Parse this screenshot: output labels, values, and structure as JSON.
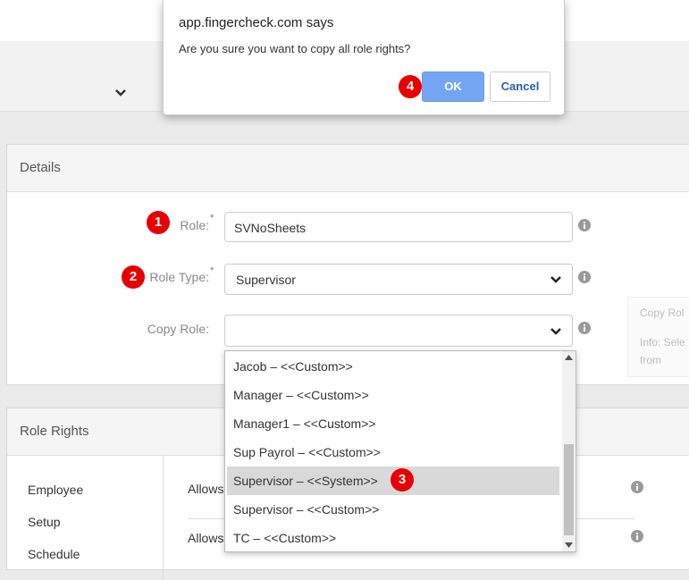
{
  "dialog": {
    "title": "app.fingercheck.com says",
    "message": "Are you sure you want to copy all role rights?",
    "ok_label": "OK",
    "cancel_label": "Cancel"
  },
  "details": {
    "heading": "Details",
    "role_label": "Role:",
    "role_value": "SVNoSheets",
    "role_type_label": "Role Type:",
    "role_type_value": "Supervisor",
    "copy_role_label": "Copy Role:",
    "copy_role_value": "",
    "required_mark": "*"
  },
  "side_tip": {
    "line1": "Copy Rol",
    "line2": "Info: Sele",
    "line3": "from"
  },
  "copy_role_options": [
    "Jacob – <<Custom>>",
    "Manager – <<Custom>>",
    "Manager1 – <<Custom>>",
    "Sup Payrol – <<Custom>>",
    "Supervisor – <<System>>",
    "Supervisor – <<Custom>>",
    "TC – <<Custom>>"
  ],
  "selected_option": "Supervisor – <<System>>",
  "role_rights": {
    "heading": "Role Rights",
    "nav": [
      "Employee",
      "Setup",
      "Schedule"
    ],
    "row_prefix_1": "Allows",
    "row_prefix_2": "Allows"
  },
  "badges": [
    "1",
    "2",
    "3",
    "4"
  ],
  "colors": {
    "badge": "#e60000",
    "ok_button": "#73a5f2",
    "cancel_text": "#2a5db0"
  }
}
